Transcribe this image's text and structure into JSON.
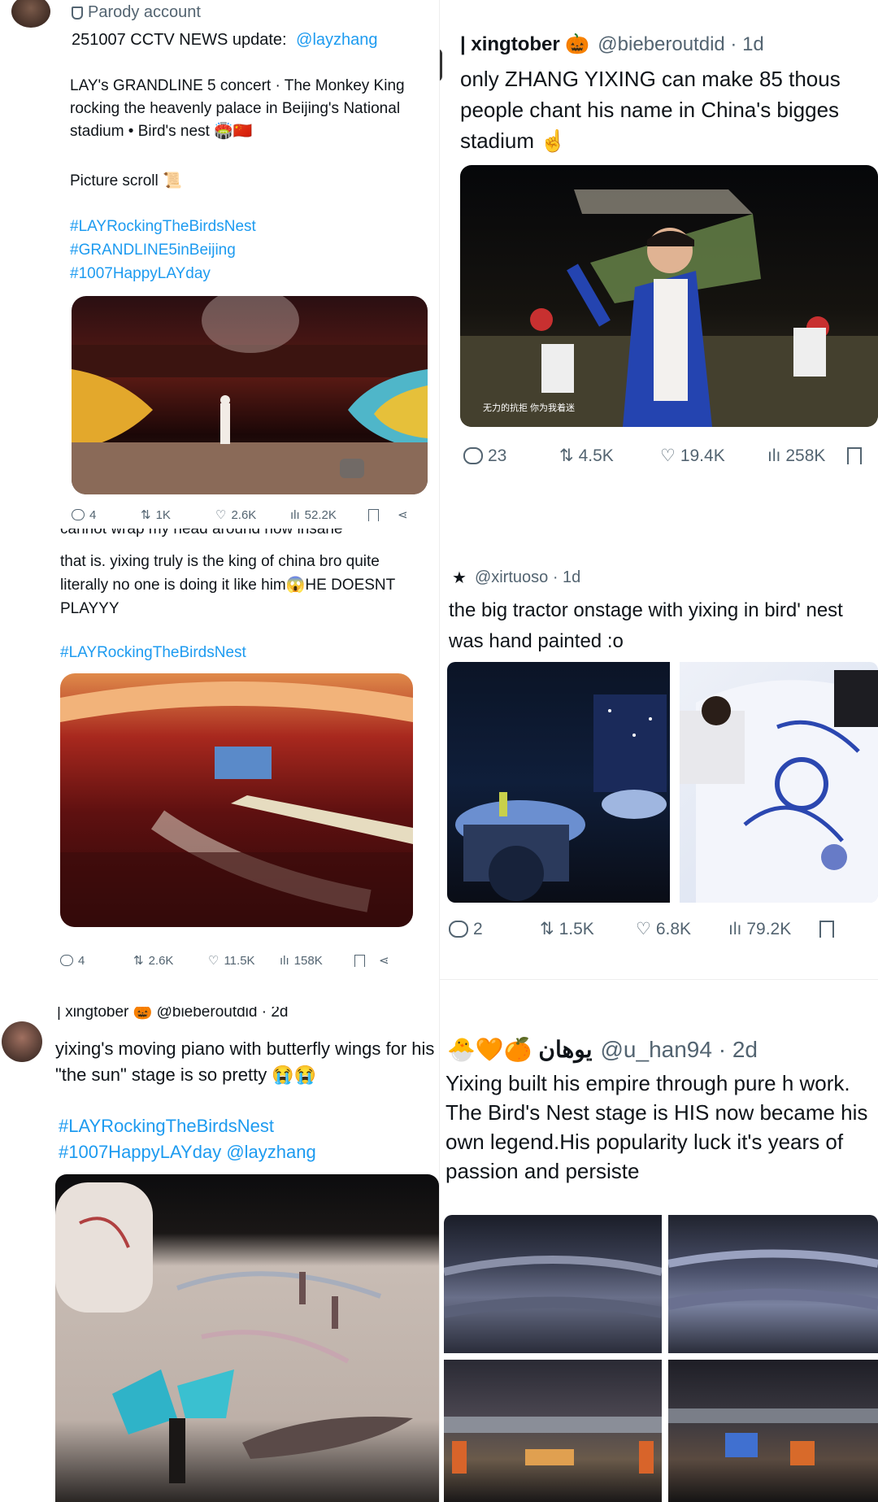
{
  "tweet1": {
    "account_label": "Parody account",
    "header_line": "251007 CCTV NEWS update:",
    "mention": "@layzhang",
    "body": "LAY's GRANDLINE 5 concert · The Monkey King rocking the heavenly palace in Beijing's National stadium • Bird's nest 🏟️🇨🇳",
    "scroll_label": "Picture scroll 📜",
    "hashtags": [
      "#LAYRockingTheBirdsNest",
      "#GRANDLINE5inBeijing",
      "#1007HappyLAYday"
    ],
    "stats": {
      "replies": "4",
      "reposts": "1K",
      "likes": "2.6K",
      "views": "52.2K"
    }
  },
  "tweet2": {
    "display_name": "| xingtober 🎃",
    "handle_time": "@bieberoutdid · 1d",
    "body": "only ZHANG YIXING can make 85 thous people chant his name in China's bigges stadium ☝️",
    "caption_overlay": "无力的抗拒 你为我着迷",
    "stats": {
      "replies": "23",
      "reposts": "4.5K",
      "likes": "19.4K",
      "views": "258K"
    }
  },
  "tweet3": {
    "body_cut": "cannot wrap my head around how insane",
    "body": "that is. yixing truly is the king of china bro quite literally no one is doing it like him😱HE DOESNT PLAYYY",
    "hashtag": "#LAYRockingTheBirdsNest",
    "stats": {
      "replies": "4",
      "reposts": "2.6K",
      "likes": "11.5K",
      "views": "158K"
    }
  },
  "tweet4": {
    "handle_time": "@xirtuoso · 1d",
    "body": "the big tractor onstage with yixing in bird' nest was hand painted :o",
    "stats": {
      "replies": "2",
      "reposts": "1.5K",
      "likes": "6.8K",
      "views": "79.2K"
    }
  },
  "tweet5": {
    "header_cut": "| xingtober 🎃 @bieberoutdid · 2d",
    "body": "yixing's moving piano with butterfly wings for his \"the sun\" stage is so pretty 😭😭",
    "hashtags": [
      "#LAYRockingTheBirdsNest"
    ],
    "hashtag_line2": "#1007HappyLAYday",
    "mention": "@layzhang"
  },
  "tweet6": {
    "display_name": "🐣🧡🍊 يوهان",
    "handle_time": "@u_han94 · 2d",
    "body": "Yixing built his empire through pure h work. The Bird's Nest stage is HIS now became his own legend.His popularity luck it's years of passion and persiste"
  },
  "colors": {
    "link": "#1d9bf0",
    "text": "#0f1419",
    "muted": "#536471"
  }
}
